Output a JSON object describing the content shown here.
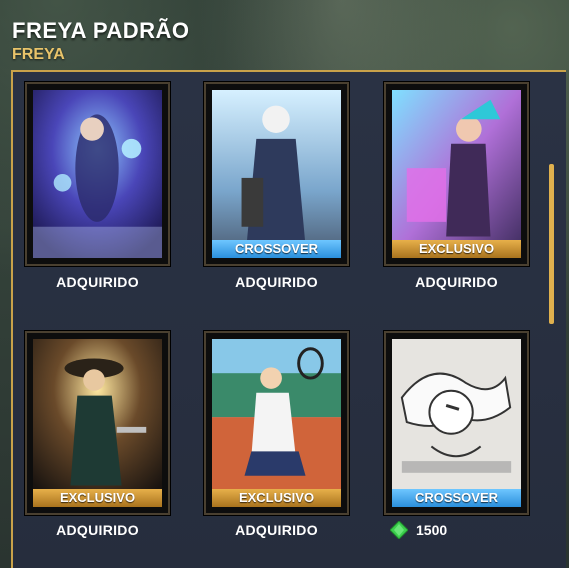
{
  "header": {
    "skin_title": "FREYA PADRÃO",
    "god_name": "FREYA"
  },
  "colors": {
    "gold": "#e9c46a",
    "crossover": "#2b8fdc",
    "exclusivo": "#a9731e",
    "gem": "#3ccf4e"
  },
  "cards": [
    {
      "tag": "",
      "status": "ADQUIRIDO"
    },
    {
      "tag": "CROSSOVER",
      "status": "ADQUIRIDO"
    },
    {
      "tag": "EXCLUSIVO",
      "status": "ADQUIRIDO"
    },
    {
      "tag": "EXCLUSIVO",
      "status": "ADQUIRIDO"
    },
    {
      "tag": "EXCLUSIVO",
      "status": "ADQUIRIDO"
    },
    {
      "tag": "CROSSOVER",
      "status": "",
      "price": "1500",
      "price_icon": "gem-icon"
    }
  ]
}
